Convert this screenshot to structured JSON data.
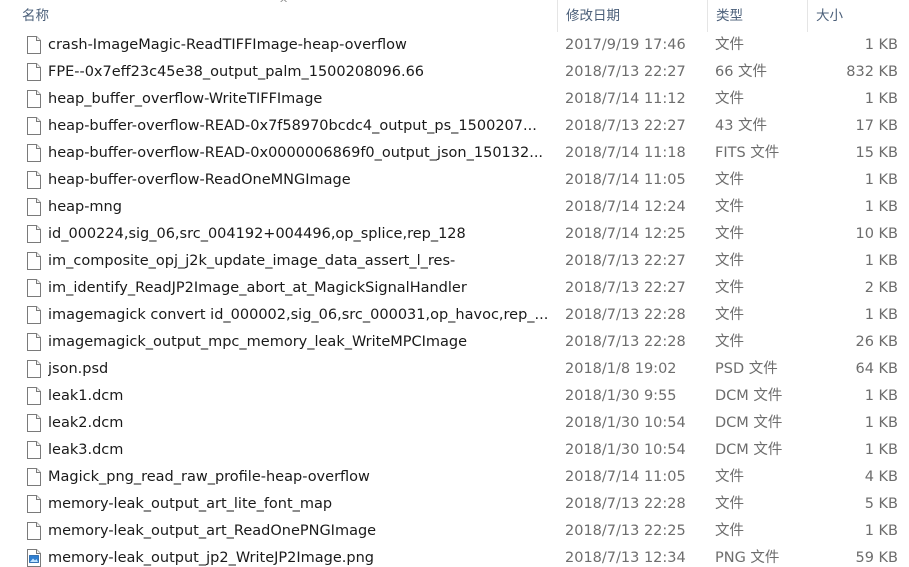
{
  "columns": {
    "name": "名称",
    "date": "修改日期",
    "type": "类型",
    "size": "大小"
  },
  "sort_indicator": "^",
  "files": [
    {
      "name": "crash-ImageMagic-ReadTIFFImage-heap-overflow",
      "date": "2017/9/19 17:46",
      "type": "文件",
      "size": "1 KB",
      "icon": "blank-file-icon"
    },
    {
      "name": "FPE--0x7eff23c45e38_output_palm_1500208096.66",
      "date": "2018/7/13 22:27",
      "type": "66 文件",
      "size": "832 KB",
      "icon": "blank-file-icon"
    },
    {
      "name": "heap_buffer_overflow-WriteTIFFImage",
      "date": "2018/7/14 11:12",
      "type": "文件",
      "size": "1 KB",
      "icon": "blank-file-icon"
    },
    {
      "name": "heap-buffer-overflow-READ-0x7f58970bcdc4_output_ps_1500207...",
      "date": "2018/7/13 22:27",
      "type": "43 文件",
      "size": "17 KB",
      "icon": "blank-file-icon"
    },
    {
      "name": "heap-buffer-overflow-READ-0x0000006869f0_output_json_150132...",
      "date": "2018/7/14 11:18",
      "type": "FITS 文件",
      "size": "15 KB",
      "icon": "blank-file-icon"
    },
    {
      "name": "heap-buffer-overflow-ReadOneMNGImage",
      "date": "2018/7/14 11:05",
      "type": "文件",
      "size": "1 KB",
      "icon": "blank-file-icon"
    },
    {
      "name": "heap-mng",
      "date": "2018/7/14 12:24",
      "type": "文件",
      "size": "1 KB",
      "icon": "blank-file-icon"
    },
    {
      "name": "id_000224,sig_06,src_004192+004496,op_splice,rep_128",
      "date": "2018/7/14 12:25",
      "type": "文件",
      "size": "10 KB",
      "icon": "blank-file-icon"
    },
    {
      "name": "im_composite_opj_j2k_update_image_data_assert_l_res-",
      "date": "2018/7/13 22:27",
      "type": "文件",
      "size": "1 KB",
      "icon": "blank-file-icon"
    },
    {
      "name": "im_identify_ReadJP2Image_abort_at_MagickSignalHandler",
      "date": "2018/7/13 22:27",
      "type": "文件",
      "size": "2 KB",
      "icon": "blank-file-icon"
    },
    {
      "name": "imagemagick convert id_000002,sig_06,src_000031,op_havoc,rep_...",
      "date": "2018/7/13 22:28",
      "type": "文件",
      "size": "1 KB",
      "icon": "blank-file-icon"
    },
    {
      "name": "imagemagick_output_mpc_memory_leak_WriteMPCImage",
      "date": "2018/7/13 22:28",
      "type": "文件",
      "size": "26 KB",
      "icon": "blank-file-icon"
    },
    {
      "name": "json.psd",
      "date": "2018/1/8 19:02",
      "type": "PSD 文件",
      "size": "64 KB",
      "icon": "blank-file-icon"
    },
    {
      "name": "leak1.dcm",
      "date": "2018/1/30 9:55",
      "type": "DCM 文件",
      "size": "1 KB",
      "icon": "blank-file-icon"
    },
    {
      "name": "leak2.dcm",
      "date": "2018/1/30 10:54",
      "type": "DCM 文件",
      "size": "1 KB",
      "icon": "blank-file-icon"
    },
    {
      "name": "leak3.dcm",
      "date": "2018/1/30 10:54",
      "type": "DCM 文件",
      "size": "1 KB",
      "icon": "blank-file-icon"
    },
    {
      "name": "Magick_png_read_raw_profile-heap-overflow",
      "date": "2018/7/14 11:05",
      "type": "文件",
      "size": "4 KB",
      "icon": "blank-file-icon"
    },
    {
      "name": "memory-leak_output_art_lite_font_map",
      "date": "2018/7/13 22:28",
      "type": "文件",
      "size": "5 KB",
      "icon": "blank-file-icon"
    },
    {
      "name": "memory-leak_output_art_ReadOnePNGImage",
      "date": "2018/7/13 22:25",
      "type": "文件",
      "size": "1 KB",
      "icon": "blank-file-icon"
    },
    {
      "name": "memory-leak_output_jp2_WriteJP2Image.png",
      "date": "2018/7/13 12:34",
      "type": "PNG 文件",
      "size": "59 KB",
      "icon": "png-image-file-icon"
    }
  ]
}
